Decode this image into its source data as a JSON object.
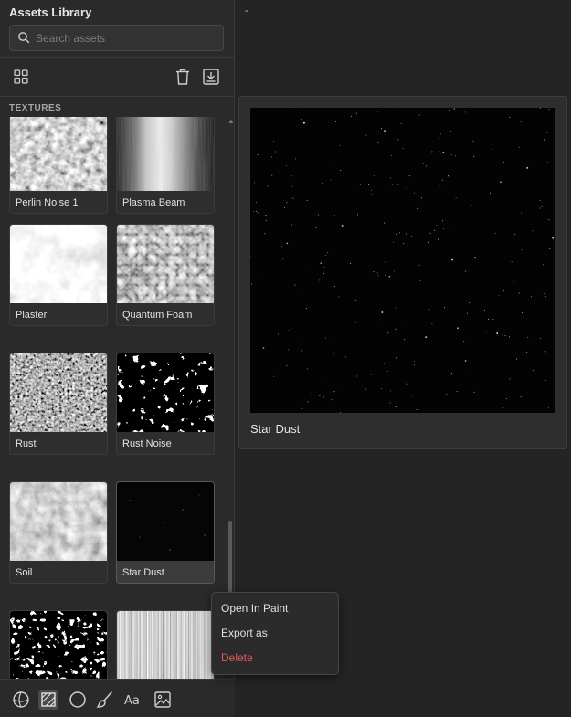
{
  "sidebar": {
    "title": "Assets Library",
    "search": {
      "placeholder": "Search assets",
      "value": ""
    },
    "section": "TEXTURES",
    "cards": [
      {
        "label": "Perlin Noise 1",
        "icon": "perlin-noise-thumbnail"
      },
      {
        "label": "Plasma Beam",
        "icon": "plasma-beam-thumbnail"
      },
      {
        "label": "Plaster",
        "icon": "plaster-thumbnail"
      },
      {
        "label": "Quantum Foam",
        "icon": "quantum-foam-thumbnail"
      },
      {
        "label": "Rust",
        "icon": "rust-thumbnail"
      },
      {
        "label": "Rust Noise",
        "icon": "rust-noise-thumbnail"
      },
      {
        "label": "Soil",
        "icon": "soil-thumbnail"
      },
      {
        "label": "Star Dust",
        "icon": "star-dust-thumbnail"
      },
      {
        "label": "",
        "icon": "voronoi-thumbnail"
      },
      {
        "label": "",
        "icon": "stripes-thumbnail"
      }
    ],
    "bottom_tools": [
      "sphere-icon",
      "texture-icon",
      "circle-icon",
      "brush-icon",
      "text-icon",
      "image-icon"
    ]
  },
  "top_dash": "-",
  "preview": {
    "title": "Star Dust"
  },
  "context_menu": {
    "open_label": "Open In Paint",
    "export_label": "Export as",
    "delete_label": "Delete",
    "delete_color": "#e05a5a"
  }
}
